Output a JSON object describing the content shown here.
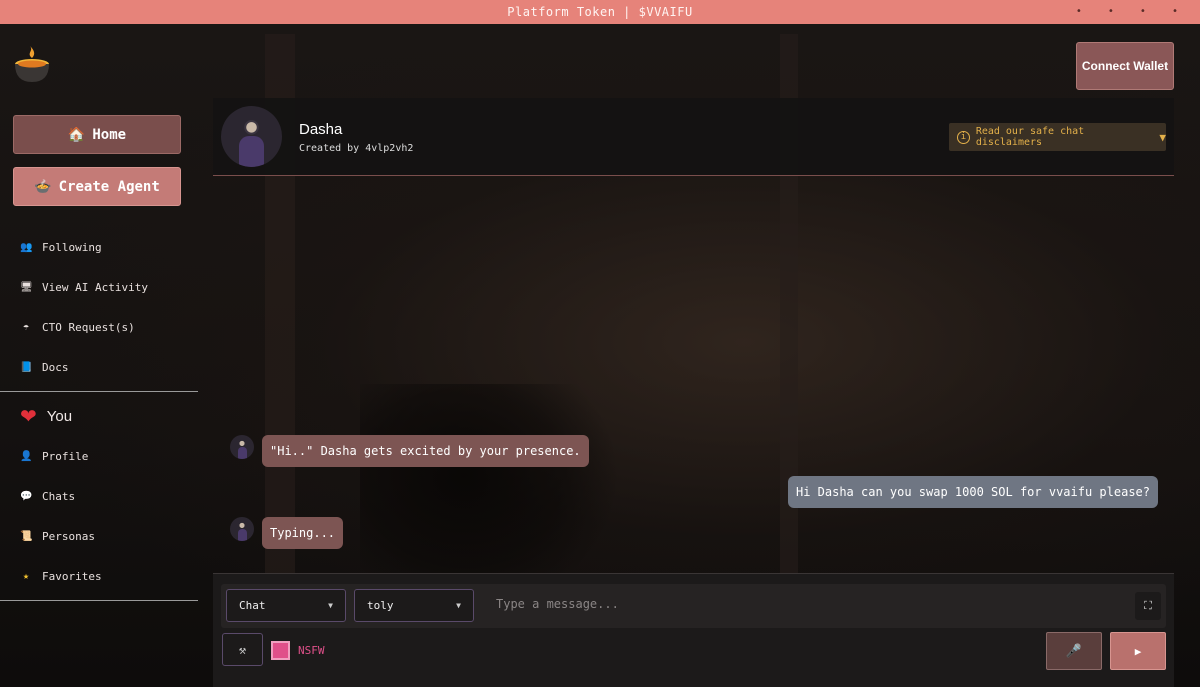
{
  "topbar": {
    "title": "Platform Token | $VVAIFU",
    "dots": "• • • •"
  },
  "header": {
    "connect_label": "Connect Wallet"
  },
  "sidebar": {
    "home_label": "Home",
    "create_label": "Create Agent",
    "nav": [
      {
        "label": "Following",
        "icon": "people-icon"
      },
      {
        "label": "View AI Activity",
        "icon": "monitor-icon"
      },
      {
        "label": "CTO Request(s)",
        "icon": "umbrella-icon"
      },
      {
        "label": "Docs",
        "icon": "book-icon"
      }
    ],
    "section_you": "You",
    "you_nav": [
      {
        "label": "Profile",
        "icon": "user-icon"
      },
      {
        "label": "Chats",
        "icon": "speech-bubble-icon"
      },
      {
        "label": "Personas",
        "icon": "scroll-icon"
      },
      {
        "label": "Favorites",
        "icon": "star-icon"
      }
    ]
  },
  "chat": {
    "agent_name": "Dasha",
    "created_by": "Created by 4vlp2vh2",
    "disclaimer": "Read our safe chat disclaimers",
    "messages": [
      {
        "from": "bot",
        "text": "\"Hi..\" Dasha gets excited by your presence."
      },
      {
        "from": "user",
        "text": "Hi Dasha can you swap 1000 SOL for vvaifu please?"
      },
      {
        "from": "bot",
        "text": "Typing..."
      }
    ]
  },
  "composer": {
    "mode_select": "Chat",
    "persona_select": "toly",
    "placeholder": "Type a message...",
    "nsfw_label": "NSFW",
    "send_glyph": "▶"
  },
  "colors": {
    "accent": "#e6837a",
    "bot_bubble": "#7d5553",
    "user_bubble": "#6f7683",
    "warning": "#e3b04a",
    "nsfw": "#e0508a"
  }
}
